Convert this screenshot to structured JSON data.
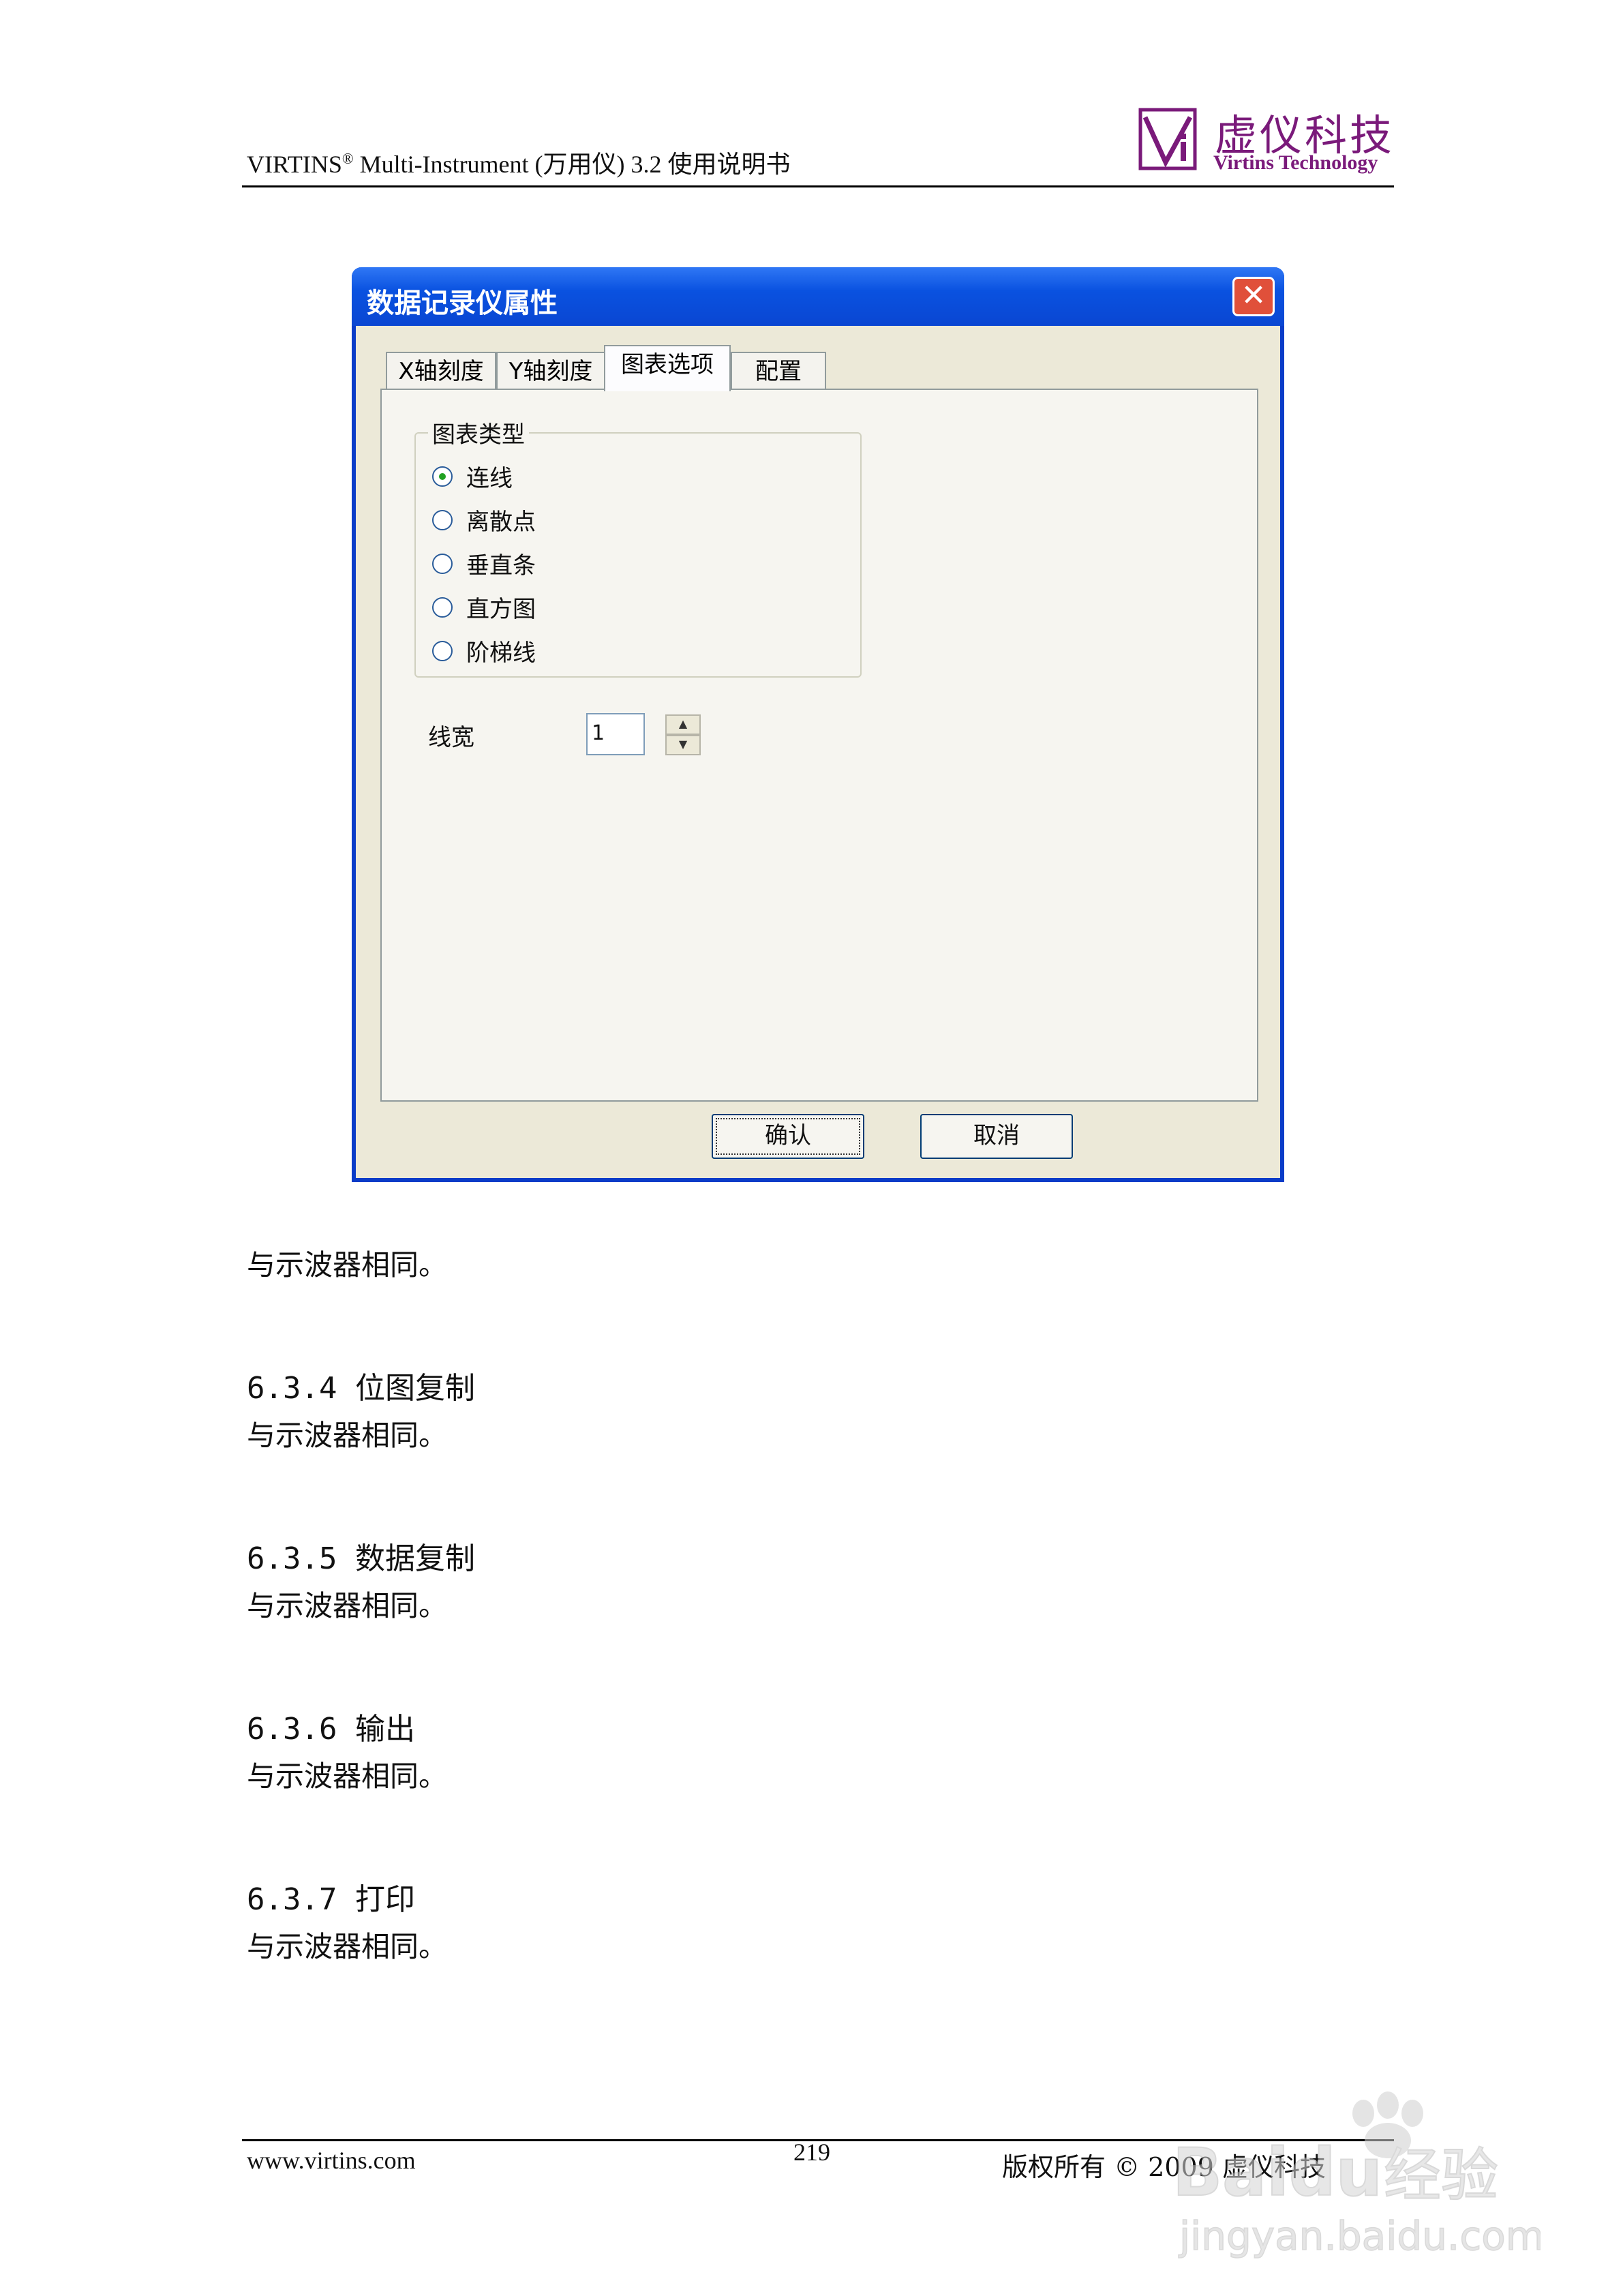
{
  "header": {
    "brand": "VIRTINS",
    "brand_mark": "®",
    "title_rest": " Multi-Instrument (万用仪) 3.2 使用说明书",
    "logo_cn": "虚仪科技",
    "logo_en": "Virtins Technology"
  },
  "dialog": {
    "title": "数据记录仪属性",
    "close": "✕",
    "tabs": [
      "X轴刻度",
      "Y轴刻度",
      "图表选项",
      "配置"
    ],
    "active_tab": "图表选项",
    "chart_type_group": {
      "label": "图表类型",
      "options": [
        "连线",
        "离散点",
        "垂直条",
        "直方图",
        "阶梯线"
      ],
      "selected": "连线"
    },
    "line_width": {
      "label": "线宽",
      "value": "1"
    },
    "buttons": {
      "ok": "确认",
      "cancel": "取消"
    }
  },
  "body": {
    "p1": "与示波器相同。",
    "sections": [
      {
        "heading": "6.3.4 位图复制",
        "text": "与示波器相同。"
      },
      {
        "heading": "6.3.5 数据复制",
        "text": "与示波器相同。"
      },
      {
        "heading": "6.3.6 输出",
        "text": "与示波器相同。"
      },
      {
        "heading": "6.3.7 打印",
        "text": "与示波器相同。"
      }
    ]
  },
  "footer": {
    "website": "www.virtins.com",
    "page": "219",
    "copyright": "版权所有 © 2009 虚仪科技"
  },
  "watermark": {
    "top": "Baidu经验",
    "bottom": "jingyan.baidu.com"
  }
}
